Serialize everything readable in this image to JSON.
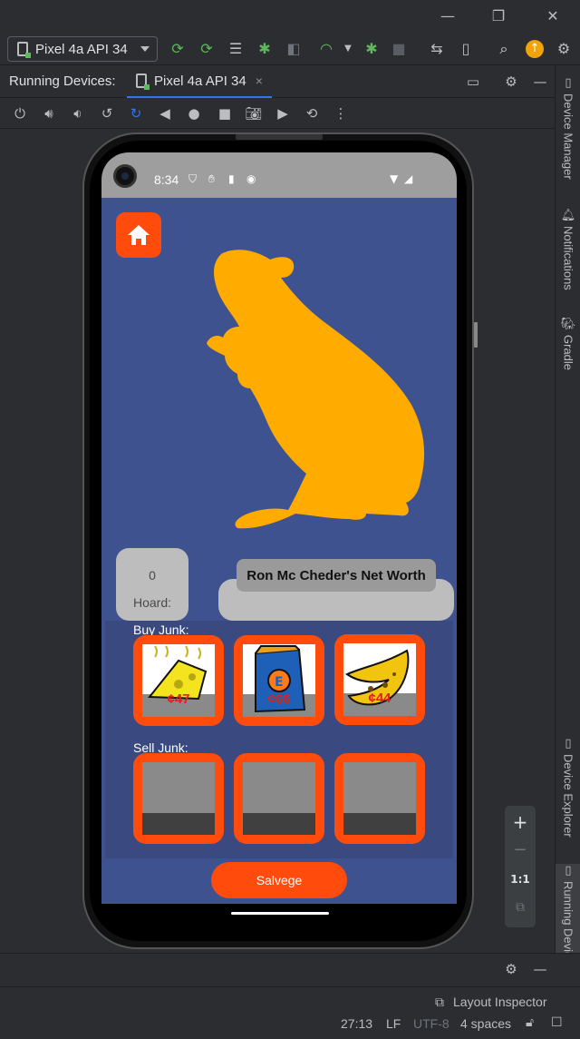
{
  "window": {
    "minimize": "—",
    "restore": "❐",
    "close": "✕"
  },
  "toolbar": {
    "device_selector": "Pixel 4a API 34"
  },
  "running_devices": {
    "label": "Running Devices:",
    "tab": "Pixel 4a API 34",
    "tab_close": "×"
  },
  "right_strip": {
    "device_manager": "Device Manager",
    "notifications": "Notifications",
    "gradle": "Gradle",
    "device_explorer": "Device Explorer",
    "running_devices": "Running Devices"
  },
  "zoom": {
    "plus": "+",
    "minus": "−",
    "one_to_one": "1:1"
  },
  "phone": {
    "time": "8:34",
    "hoard": {
      "value": "0",
      "label": "Hoard:"
    },
    "net_worth_title": "Ron Mc Cheder's Net Worth",
    "buy_label": "Buy Junk:",
    "sell_label": "Sell Junk:",
    "buy_items": [
      {
        "name": "cheese",
        "price": "¢47"
      },
      {
        "name": "chips",
        "price": "¢66"
      },
      {
        "name": "banana",
        "price": "¢44"
      }
    ],
    "salvage_label": "Salvege",
    "colors": {
      "accent": "#ff4c0d",
      "background": "#3f5290",
      "rat": "#ffab00"
    }
  },
  "statusbar": {
    "layout_inspector": "Layout Inspector",
    "position": "27:13",
    "line_ending": "LF",
    "encoding": "UTF-8",
    "indent": "4 spaces"
  }
}
